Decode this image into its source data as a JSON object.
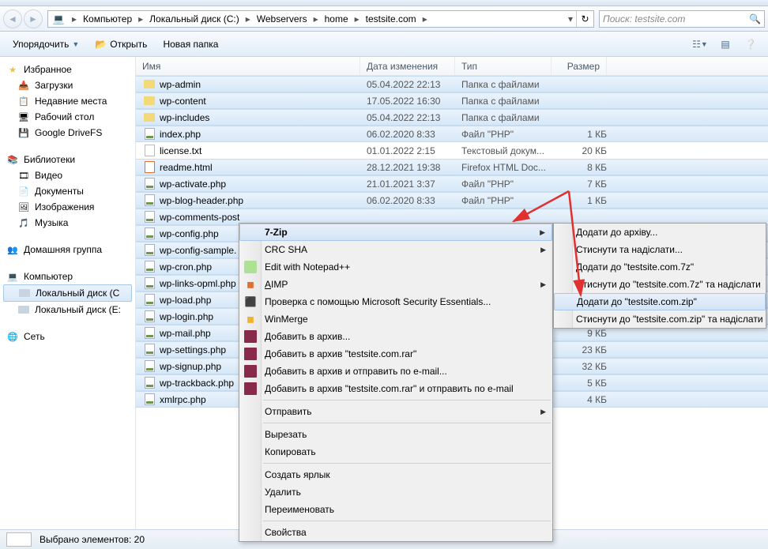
{
  "breadcrumb": [
    "Компьютер",
    "Локальный диск (C:)",
    "Webservers",
    "home",
    "testsite.com"
  ],
  "search_placeholder": "Поиск: testsite.com",
  "toolbar": {
    "organize": "Упорядочить",
    "open": "Открыть",
    "new_folder": "Новая папка"
  },
  "columns": {
    "name": "Имя",
    "date": "Дата изменения",
    "type": "Тип",
    "size": "Размер"
  },
  "sidebar": {
    "favorites": {
      "label": "Избранное",
      "items": [
        "Загрузки",
        "Недавние места",
        "Рабочий стол",
        "Google DriveFS"
      ]
    },
    "libraries": {
      "label": "Библиотеки",
      "items": [
        "Видео",
        "Документы",
        "Изображения",
        "Музыка"
      ]
    },
    "homegroup": "Домашняя группа",
    "computer": {
      "label": "Компьютер",
      "items": [
        "Локальный диск (C",
        "Локальный диск (E:"
      ]
    },
    "network": "Сеть"
  },
  "files": [
    {
      "name": "wp-admin",
      "date": "05.04.2022 22:13",
      "type": "Папка с файлами",
      "size": "",
      "icon": "folder",
      "sel": true
    },
    {
      "name": "wp-content",
      "date": "17.05.2022 16:30",
      "type": "Папка с файлами",
      "size": "",
      "icon": "folder",
      "sel": true
    },
    {
      "name": "wp-includes",
      "date": "05.04.2022 22:13",
      "type": "Папка с файлами",
      "size": "",
      "icon": "folder",
      "sel": true
    },
    {
      "name": "index.php",
      "date": "06.02.2020 8:33",
      "type": "Файл \"PHP\"",
      "size": "1 КБ",
      "icon": "php",
      "sel": true
    },
    {
      "name": "license.txt",
      "date": "01.01.2022 2:15",
      "type": "Текстовый докум...",
      "size": "20 КБ",
      "icon": "txt",
      "sel": false
    },
    {
      "name": "readme.html",
      "date": "28.12.2021 19:38",
      "type": "Firefox HTML Doc...",
      "size": "8 КБ",
      "icon": "html",
      "sel": true
    },
    {
      "name": "wp-activate.php",
      "date": "21.01.2021 3:37",
      "type": "Файл \"PHP\"",
      "size": "7 КБ",
      "icon": "php",
      "sel": true
    },
    {
      "name": "wp-blog-header.php",
      "date": "06.02.2020 8:33",
      "type": "Файл \"PHP\"",
      "size": "1 КБ",
      "icon": "php",
      "sel": true
    },
    {
      "name": "wp-comments-post",
      "date": "",
      "type": "",
      "size": "",
      "icon": "php",
      "sel": true
    },
    {
      "name": "wp-config.php",
      "date": "",
      "type": "",
      "size": "",
      "icon": "php",
      "sel": true
    },
    {
      "name": "wp-config-sample.",
      "date": "",
      "type": "",
      "size": "",
      "icon": "php",
      "sel": true
    },
    {
      "name": "wp-cron.php",
      "date": "",
      "type": "",
      "size": "",
      "icon": "php",
      "sel": true
    },
    {
      "name": "wp-links-opml.php",
      "date": "",
      "type": "",
      "size": "",
      "icon": "php",
      "sel": true
    },
    {
      "name": "wp-load.php",
      "date": "",
      "type": "",
      "size": "",
      "icon": "php",
      "sel": true
    },
    {
      "name": "wp-login.php",
      "date": "",
      "type": "",
      "size": "",
      "icon": "php",
      "sel": true
    },
    {
      "name": "wp-mail.php",
      "date": "",
      "type": "",
      "size": "9 КБ",
      "icon": "php",
      "sel": true
    },
    {
      "name": "wp-settings.php",
      "date": "",
      "type": "",
      "size": "23 КБ",
      "icon": "php",
      "sel": true
    },
    {
      "name": "wp-signup.php",
      "date": "",
      "type": "",
      "size": "32 КБ",
      "icon": "php",
      "sel": true
    },
    {
      "name": "wp-trackback.php",
      "date": "",
      "type": "",
      "size": "5 КБ",
      "icon": "php",
      "sel": true
    },
    {
      "name": "xmlrpc.php",
      "date": "",
      "type": "",
      "size": "4 КБ",
      "icon": "php",
      "sel": true
    }
  ],
  "context_menu": {
    "items": [
      {
        "label": "7-Zip",
        "arrow": true,
        "bold": true,
        "hover": true
      },
      {
        "label": "CRC SHA",
        "arrow": true
      },
      {
        "label": "Edit with Notepad++",
        "icon": "npp"
      },
      {
        "label": "AIMP",
        "arrow": true,
        "underline": "A",
        "icon": "aimp"
      },
      {
        "label": "Проверка с помощью Microsoft Security Essentials...",
        "icon": "mse"
      },
      {
        "label": "WinMerge",
        "icon": "wm"
      },
      {
        "label": "Добавить в архив...",
        "icon": "rar"
      },
      {
        "label": "Добавить в архив \"testsite.com.rar\"",
        "icon": "rar"
      },
      {
        "label": "Добавить в архив и отправить по e-mail...",
        "icon": "rar"
      },
      {
        "label": "Добавить в архив \"testsite.com.rar\" и отправить по e-mail",
        "icon": "rar"
      },
      {
        "sep": true
      },
      {
        "label": "Отправить",
        "arrow": true
      },
      {
        "sep": true
      },
      {
        "label": "Вырезать"
      },
      {
        "label": "Копировать"
      },
      {
        "sep": true
      },
      {
        "label": "Создать ярлык"
      },
      {
        "label": "Удалить"
      },
      {
        "label": "Переименовать"
      },
      {
        "sep": true
      },
      {
        "label": "Свойства"
      }
    ]
  },
  "submenu": {
    "items": [
      {
        "label": "Додати до архіву..."
      },
      {
        "label": "Стиснути та надіслати..."
      },
      {
        "label": "Додати до \"testsite.com.7z\""
      },
      {
        "label": "Стиснути до \"testsite.com.7z\" та надіслати"
      },
      {
        "label": "Додати до \"testsite.com.zip\"",
        "hover": true
      },
      {
        "label": "Стиснути до \"testsite.com.zip\" та надіслати"
      }
    ]
  },
  "status": "Выбрано элементов: 20"
}
